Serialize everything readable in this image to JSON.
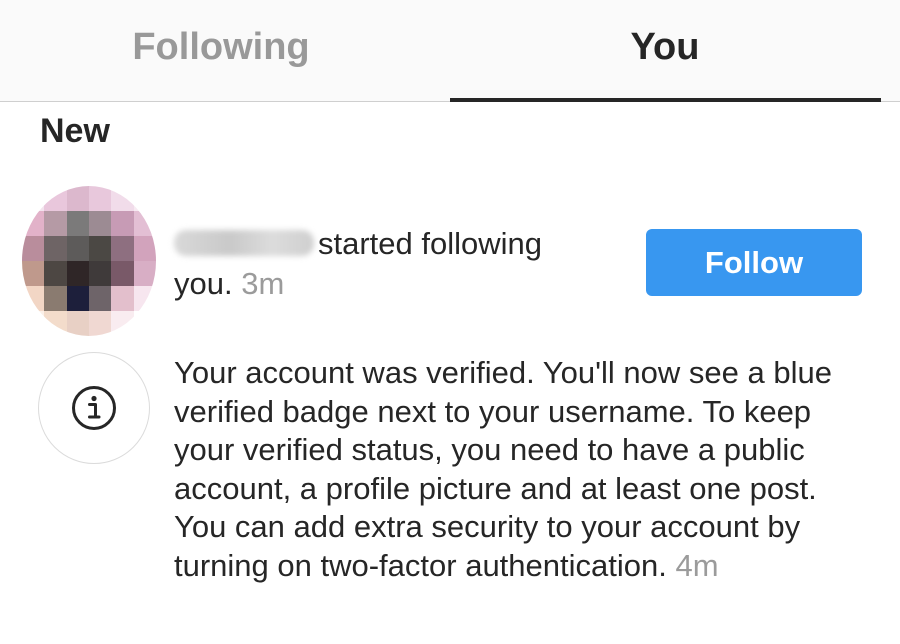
{
  "tabs": {
    "following_label": "Following",
    "you_label": "You",
    "active": "You"
  },
  "section": {
    "title": "New"
  },
  "notifications": [
    {
      "type": "follow",
      "text": "started following you.",
      "time": "3m",
      "button_label": "Follow",
      "username_obscured": true
    },
    {
      "type": "info",
      "icon": "info-icon",
      "text": "Your account was verified. You'll now see a blue verified badge next to your username. To keep your verified status, you need to have a public account, a profile picture and at least one post. You can add extra security to your account by turning on two-factor authentication.",
      "time": "4m"
    }
  ],
  "colors": {
    "accent": "#3897f0",
    "text": "#262626",
    "muted": "#999999"
  }
}
